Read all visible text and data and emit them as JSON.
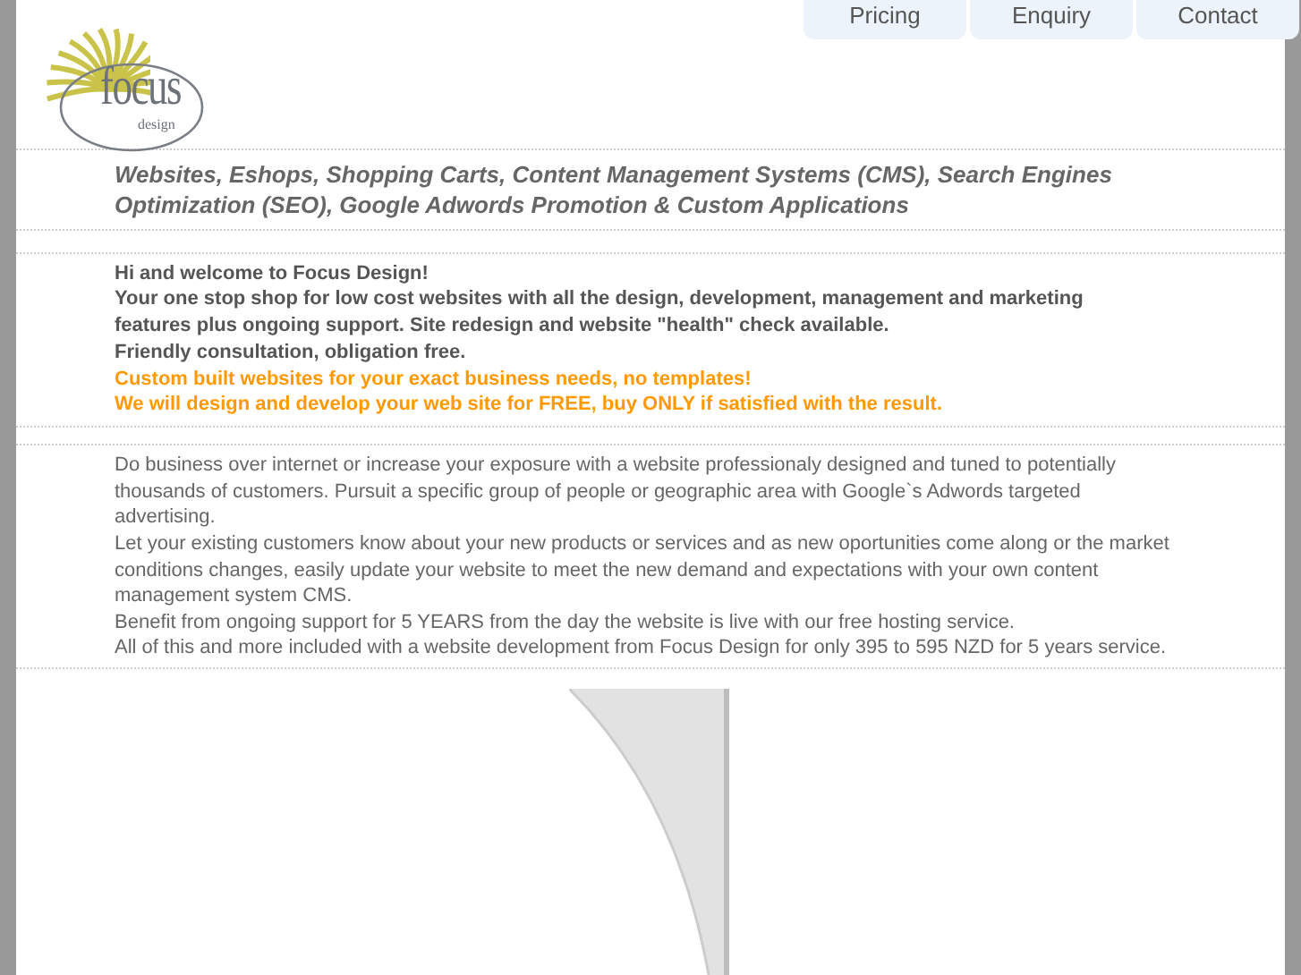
{
  "logo": {
    "name": "focus",
    "tagline": "design"
  },
  "nav": [
    {
      "label": "Pricing"
    },
    {
      "label": "Enquiry"
    },
    {
      "label": "Contact"
    }
  ],
  "headline": "Websites, Eshops, Shopping Carts, Content Management Systems (CMS), Search Engines Optimization (SEO), Google Adwords Promotion & Custom Applications",
  "intro": [
    {
      "text": "Hi and welcome to Focus Design!",
      "kind": "plain"
    },
    {
      "text": "Your one stop shop for low cost websites with all the design, development, management and marketing features plus ongoing support. Site redesign and website \"health\" check available.",
      "kind": "plain"
    },
    {
      "text": "Friendly consultation, obligation free.",
      "kind": "plain"
    },
    {
      "text": "Custom built websites for your exact business needs, no templates!",
      "kind": "highlight"
    },
    {
      "text": "We will design and develop your web site for FREE, buy ONLY if satisfied with the result.",
      "kind": "highlight"
    }
  ],
  "details": [
    "Do business over internet or increase your exposure with a website professionaly designed and tuned to potentially thousands of customers. Pursuit a specific group of people or geographic area with Google`s Adwords targeted advertising.",
    "Let your existing customers know about your new products or services and as new oportunities come along or the market conditions changes, easily update your website to meet the new demand and expectations with your own content management system CMS.",
    "Benefit from ongoing support for 5 YEARS from the day the website is live with our free hosting service.",
    "All of this and more included with a website development from Focus Design for only 395 to 595 NZD for 5 years service."
  ]
}
